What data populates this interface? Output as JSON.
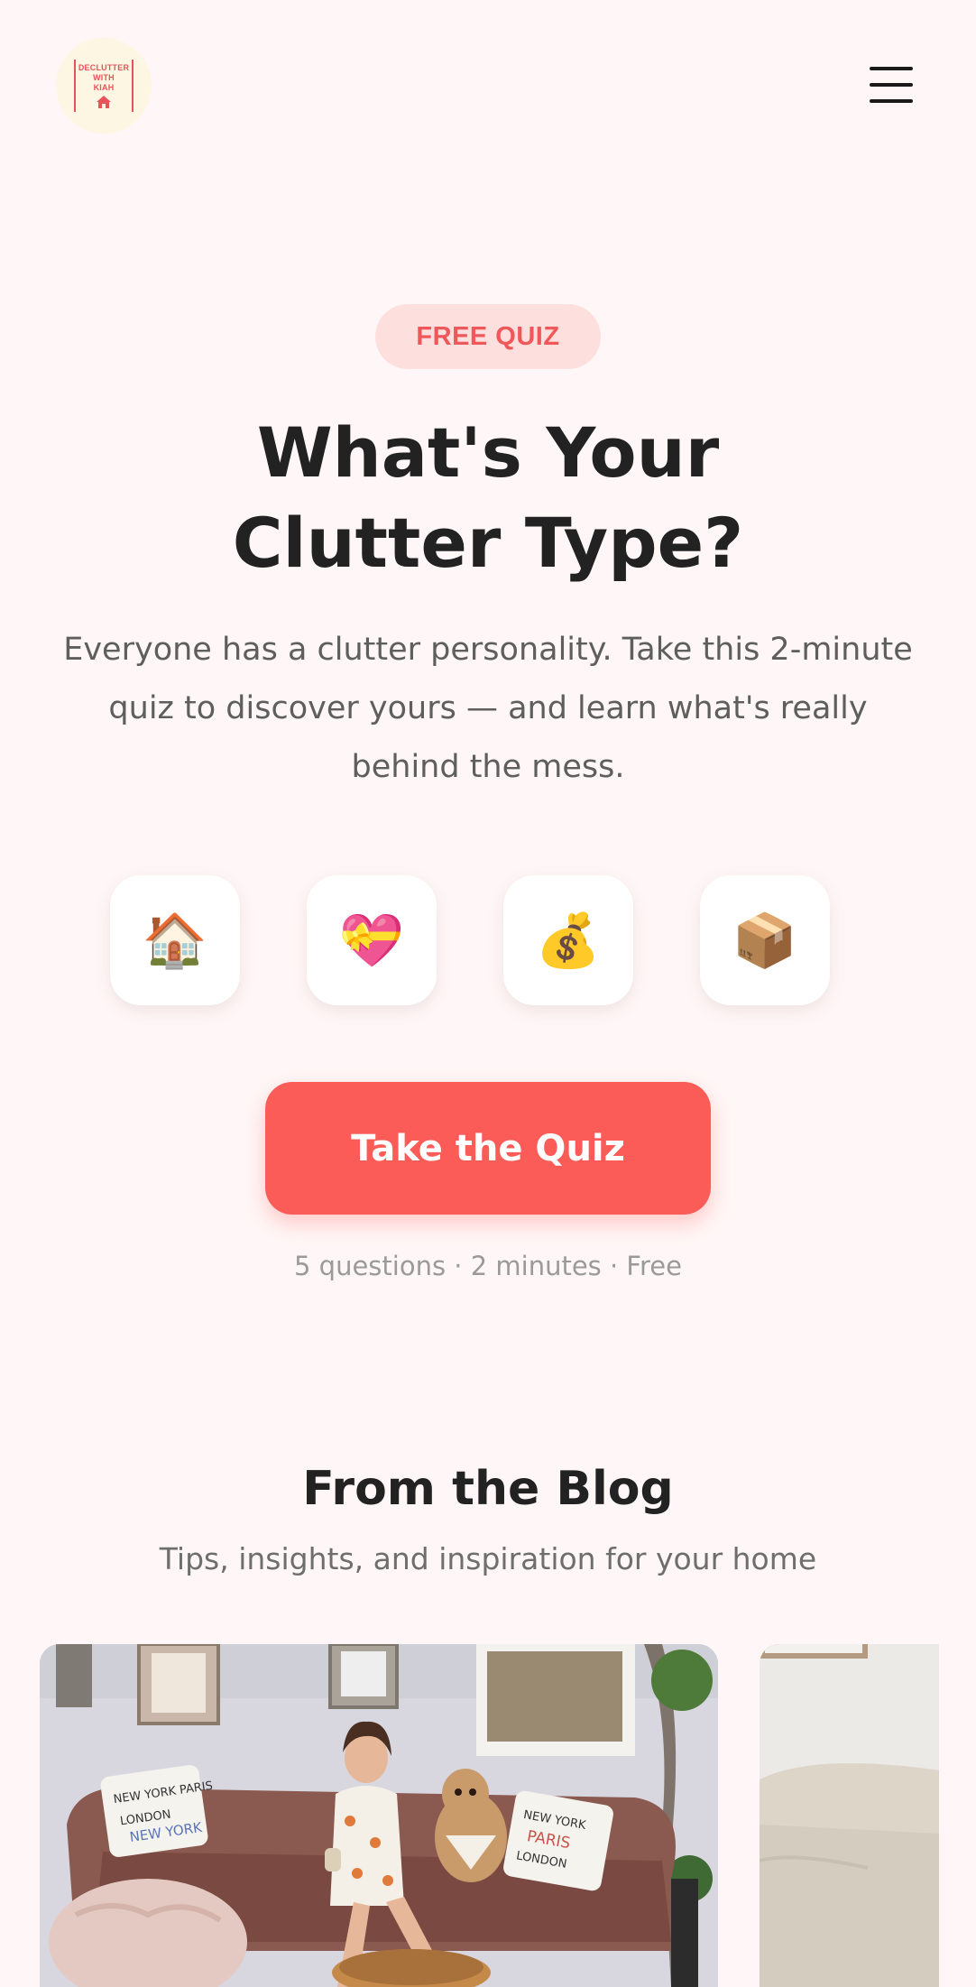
{
  "brand": {
    "logo_lines": [
      "DECLUTTER",
      "WITH",
      "KIAH"
    ],
    "accent_color": "#fb5c58",
    "background_color": "#fff7f7"
  },
  "header": {
    "menu_icon": "hamburger-menu-icon"
  },
  "hero": {
    "badge": "FREE QUIZ",
    "title_line1": "What's Your",
    "title_line2": "Clutter Type?",
    "subtitle": "Everyone has a clutter personality. Take this 2-minute quiz to discover yours — and learn what's really behind the mess.",
    "emoji_icons": [
      {
        "name": "house-emoji-icon",
        "glyph": "🏠"
      },
      {
        "name": "heart-gift-emoji-icon",
        "glyph": "💝"
      },
      {
        "name": "money-bag-emoji-icon",
        "glyph": "💰"
      },
      {
        "name": "package-emoji-icon",
        "glyph": "📦"
      }
    ],
    "cta_label": "Take the Quiz",
    "meta": "5 questions · 2 minutes · Free"
  },
  "blog": {
    "title": "From the Blog",
    "subtitle": "Tips, insights, and inspiration for your home",
    "cards": [
      {
        "image": "woman-with-dog-on-sofa-photo"
      },
      {
        "image": "cream-sofa-photo"
      }
    ]
  }
}
